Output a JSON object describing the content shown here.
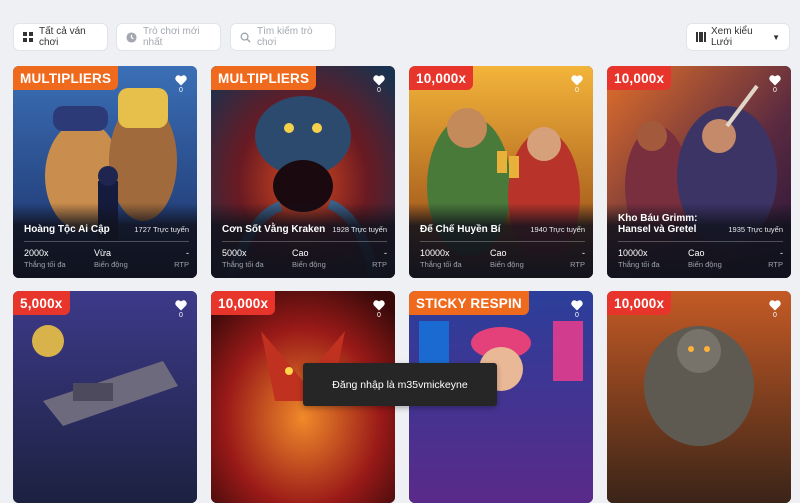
{
  "filters": {
    "all_games": "Tất cả ván chơi",
    "new_games_placeholder": "Trò chơi mới nhất",
    "search_placeholder": "Tìm kiếm trò chơi",
    "view_mode": "Xem kiểu Lưới"
  },
  "games": [
    {
      "badge": "MULTIPLIERS",
      "badge_color": "#f06a1e",
      "favorites": "0",
      "title": "Hoàng Tộc Ai Cập",
      "online": "1727 Trực tuyến",
      "max_win": "2000x",
      "max_win_label": "Thắng tối đa",
      "volatility": "Vừa",
      "volatility_label": "Biến động",
      "rtp": "-",
      "rtp_label": "RTP"
    },
    {
      "badge": "MULTIPLIERS",
      "badge_color": "#f06a1e",
      "favorites": "0",
      "title": "Cơn Sốt Vằng Kraken",
      "online": "1928 Trực tuyến",
      "max_win": "5000x",
      "max_win_label": "Thắng tối đa",
      "volatility": "Cao",
      "volatility_label": "Biến động",
      "rtp": "-",
      "rtp_label": "RTP"
    },
    {
      "badge": "10,000x",
      "badge_color": "#e8352c",
      "favorites": "0",
      "title": "Đế Chế Huyền Bí",
      "online": "1940 Trực tuyến",
      "max_win": "10000x",
      "max_win_label": "Thắng tối đa",
      "volatility": "Cao",
      "volatility_label": "Biến động",
      "rtp": "-",
      "rtp_label": "RTP"
    },
    {
      "badge": "10,000x",
      "badge_color": "#e8352c",
      "favorites": "0",
      "title": "Kho Báu Grimm: Hansel và Gretel",
      "online": "1935 Trực tuyến",
      "max_win": "10000x",
      "max_win_label": "Thắng tối đa",
      "volatility": "Cao",
      "volatility_label": "Biến động",
      "rtp": "-",
      "rtp_label": "RTP"
    },
    {
      "badge": "5,000x",
      "badge_color": "#e8352c",
      "favorites": "0"
    },
    {
      "badge": "10,000x",
      "badge_color": "#e8352c",
      "favorites": "0"
    },
    {
      "badge": "STICKY RESPIN",
      "badge_color": "#f06a1e",
      "favorites": "0"
    },
    {
      "badge": "10,000x",
      "badge_color": "#e8352c",
      "favorites": "0"
    }
  ],
  "toast": "Đăng nhập là m35vmickeyne"
}
